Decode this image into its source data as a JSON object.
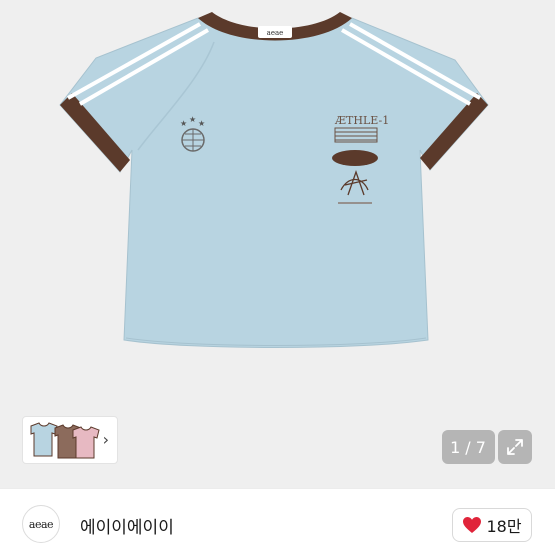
{
  "gallery": {
    "current_page": "1",
    "total_pages": "7",
    "separator": "/",
    "chevron": "›",
    "shirt": {
      "body_color": "#b8d4e1",
      "trim_color": "#5b3a2b",
      "stripe_color": "#ffffff",
      "collar_logo": "aeae",
      "chest_text": "ÆTHLE-1"
    },
    "thumbnails": [
      {
        "body_color": "#b8d4e1",
        "trim_color": "#5b3a2b"
      },
      {
        "body_color": "#8c6b5c",
        "trim_color": "#5b3a2b"
      },
      {
        "body_color": "#e7b9c2",
        "trim_color": "#5b3a2b"
      }
    ]
  },
  "seller": {
    "avatar_text": "aeae",
    "name": "에이이에이이"
  },
  "like": {
    "count": "18만",
    "heart_color": "#e0243a"
  }
}
